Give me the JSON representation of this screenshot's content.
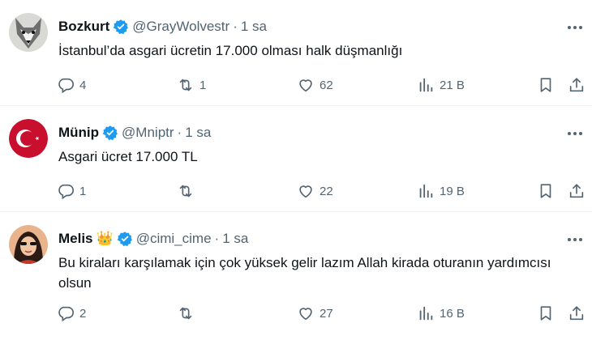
{
  "tweets": [
    {
      "name": "Bozkurt",
      "handle": "@GrayWolvestr",
      "separator": "·",
      "time": "1 sa",
      "text": "İstanbul’da asgari ücretin 17.000 olması halk düşmanlığı",
      "replies": "4",
      "retweets": "1",
      "likes": "62",
      "views": "21 B"
    },
    {
      "name": "Münip",
      "handle": "@Mniptr",
      "separator": "·",
      "time": "1 sa",
      "text": "Asgari ücret 17.000 TL",
      "replies": "1",
      "retweets": "",
      "likes": "22",
      "views": "19 B"
    },
    {
      "name": "Melis",
      "name_emoji": "👑",
      "handle": "@cimi_cime",
      "separator": "·",
      "time": "1 sa",
      "text": "Bu kiraları karşılamak için çok yüksek gelir lazım Allah kirada oturanın yardımcısı olsun",
      "replies": "2",
      "retweets": "",
      "likes": "27",
      "views": "16 B"
    }
  ],
  "colors": {
    "text": "#0f1419",
    "secondary": "#536471",
    "verified": "#1d9bf0",
    "divider": "#eff3f4"
  }
}
